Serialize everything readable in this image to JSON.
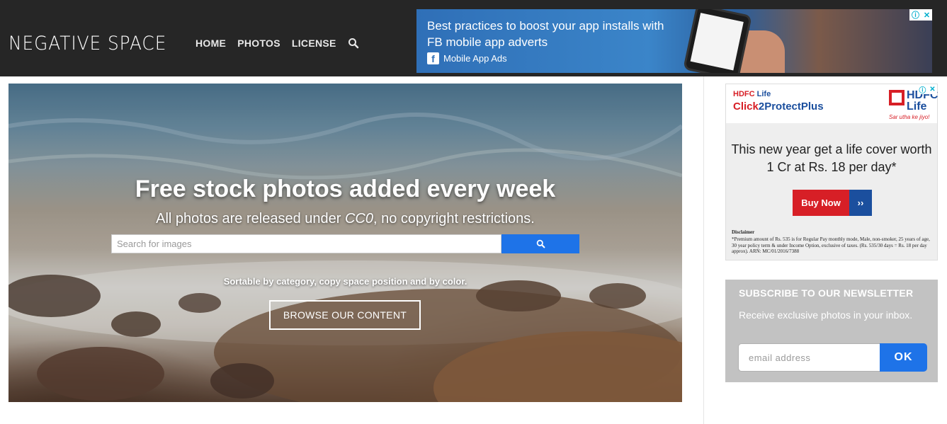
{
  "header": {
    "logo": "NEGATIVE SPACE",
    "nav": [
      "HOME",
      "PHOTOS",
      "LICENSE"
    ],
    "search_icon": "search-icon"
  },
  "top_ad": {
    "headline": "Best practices to boost your app installs with FB mobile app adverts",
    "sub": "Mobile App Ads",
    "fb_glyph": "f",
    "adchoice": [
      "ⓘ",
      "✕"
    ]
  },
  "hero": {
    "title": "Free stock photos added every week",
    "subtitle_prefix": "All photos are released under ",
    "subtitle_em": "CC0",
    "subtitle_suffix": ", no copyright restrictions.",
    "search_placeholder": "Search for images",
    "tagline": "Sortable by category, copy space position and by color.",
    "browse_label": "BROWSE OUR CONTENT"
  },
  "side_ad": {
    "brand_top_a": "HDFC",
    "brand_top_b": "Life",
    "product_a": "Click",
    "product_b": "2",
    "product_c": "ProtectPlus",
    "logo_text_1": "HDFC",
    "logo_text_2": "Life",
    "logo_tag": "Sar utha ke jiyo!",
    "headline": "This new year get a life cover worth 1 Cr at Rs. 18 per day*",
    "buy_label": "Buy Now",
    "buy_arrow": "››",
    "disclaimer_title": "Disclaimer",
    "disclaimer": "*Premium amount of Rs. 535 is for Regular Pay monthly mode, Male, non-smoker, 25 years of age, 30 year policy term & under Income Option, exclusive of taxes. (Rs. 535/30 days = Rs. 18 per day approx). ARN: MC/01/2016/7388",
    "adchoice": [
      "ⓘ",
      "✕"
    ]
  },
  "newsletter": {
    "title": "SUBSCRIBE TO OUR NEWSLETTER",
    "desc": "Receive exclusive photos in your inbox.",
    "placeholder": "email address",
    "button": "OK"
  },
  "colors": {
    "header_bg": "#262626",
    "accent_blue": "#1e73e8",
    "hdfc_red": "#d71f26",
    "hdfc_blue": "#1b4f9e",
    "newsletter_bg": "#c2c2c2"
  }
}
